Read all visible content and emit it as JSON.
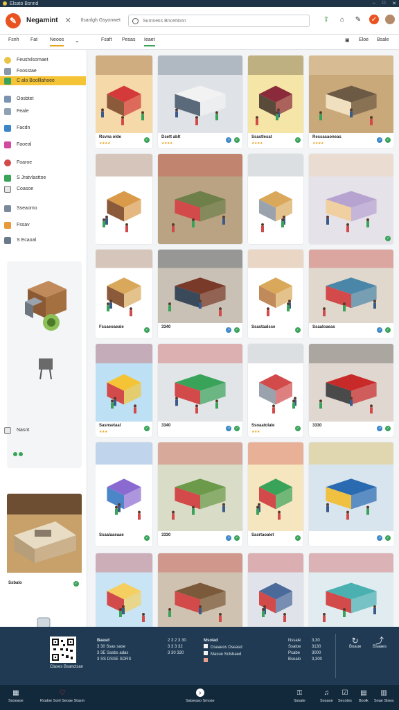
{
  "window": {
    "title": "Elsato Bsnnd",
    "controls": [
      "–",
      "□",
      "✕"
    ]
  },
  "app": {
    "name": "Negamint",
    "subtitle": "Ilsanlgh Gsyonwet",
    "search_placeholder": "Sumneks Bncehbnn"
  },
  "menu": {
    "items": [
      "Fsnh",
      "Fat",
      "Neoos",
      "Fsaft",
      "Pesas",
      "Ieaet"
    ],
    "right": [
      "Eloe",
      "Bsale"
    ]
  },
  "sidebar": {
    "items": [
      "Feustvlsomaet",
      "Foosstae",
      "C alo Boolllahoee",
      "Oosbtet",
      "Feale",
      "Facdn",
      "Faoeal",
      "Foaroe",
      "S Jratvlasttoe",
      "Coasoe",
      "Sseaomo",
      "Fssav",
      "S Ecaoal"
    ],
    "section": "Nasnt",
    "preview_label": "Ssbalo"
  },
  "cards": [
    {
      "label": "Rsvna olde",
      "stars": "★★★★"
    },
    {
      "label": "Dsett ablt",
      "stars": "★★★★"
    },
    {
      "label": "Ssastlesat",
      "stars": "★★★★"
    },
    {
      "label": "Ressasaoneas",
      "stars": "★★★★"
    },
    {
      "label": "Fssaeoaeale",
      "stars": ""
    },
    {
      "label": "3340",
      "stars": ""
    },
    {
      "label": "Ssastaalsse",
      "stars": ""
    },
    {
      "label": "Ssaaloaeas",
      "stars": ""
    },
    {
      "label": "Sasnsetaal",
      "stars": "★★★"
    },
    {
      "label": "3340",
      "stars": ""
    },
    {
      "label": "Ssoaatolale",
      "stars": "★★★"
    },
    {
      "label": "3330",
      "stars": ""
    },
    {
      "label": "Ssaalaaeaae",
      "stars": ""
    },
    {
      "label": "3330",
      "stars": ""
    },
    {
      "label": "Sasrtaoalet",
      "stars": ""
    },
    {
      "label": "",
      "stars": ""
    }
  ],
  "footer": {
    "qr_caption": "Clases Bsanctsan",
    "col1_title": "Baasd",
    "col1_lines": [
      "3 30 Ssas sase",
      "3 3E Sasbs adas",
      "3 SS DSSE SDRS"
    ],
    "col2_lines": [
      "2 3  2 3 30",
      "3 3  3 32",
      "3 30 330"
    ],
    "col3_title": "Msoiad",
    "col3_lines": [
      "Dseaeos Dseasd",
      "Masue Sclsbaed",
      ""
    ],
    "col4_lines": [
      "Nssale",
      "Ssaloe",
      "Pcabe",
      "Bsoalo"
    ],
    "col4_vals": [
      "3,30",
      "3130",
      "3000",
      "3,300"
    ],
    "col5_labels": [
      "Boaue",
      "Bsaaes"
    ]
  },
  "bottombar": {
    "items": [
      "Ssoeaoe",
      "Rsaloe Sonl Seoae Stasm",
      "Satseaso Smose",
      "Sssate",
      "Sosaoe",
      "Secotes",
      "Boolk",
      "Soae Slsea"
    ]
  },
  "colors": {
    "accent": "#e8a31f",
    "brand": "#e8531f",
    "footer": "#1f3a52"
  }
}
